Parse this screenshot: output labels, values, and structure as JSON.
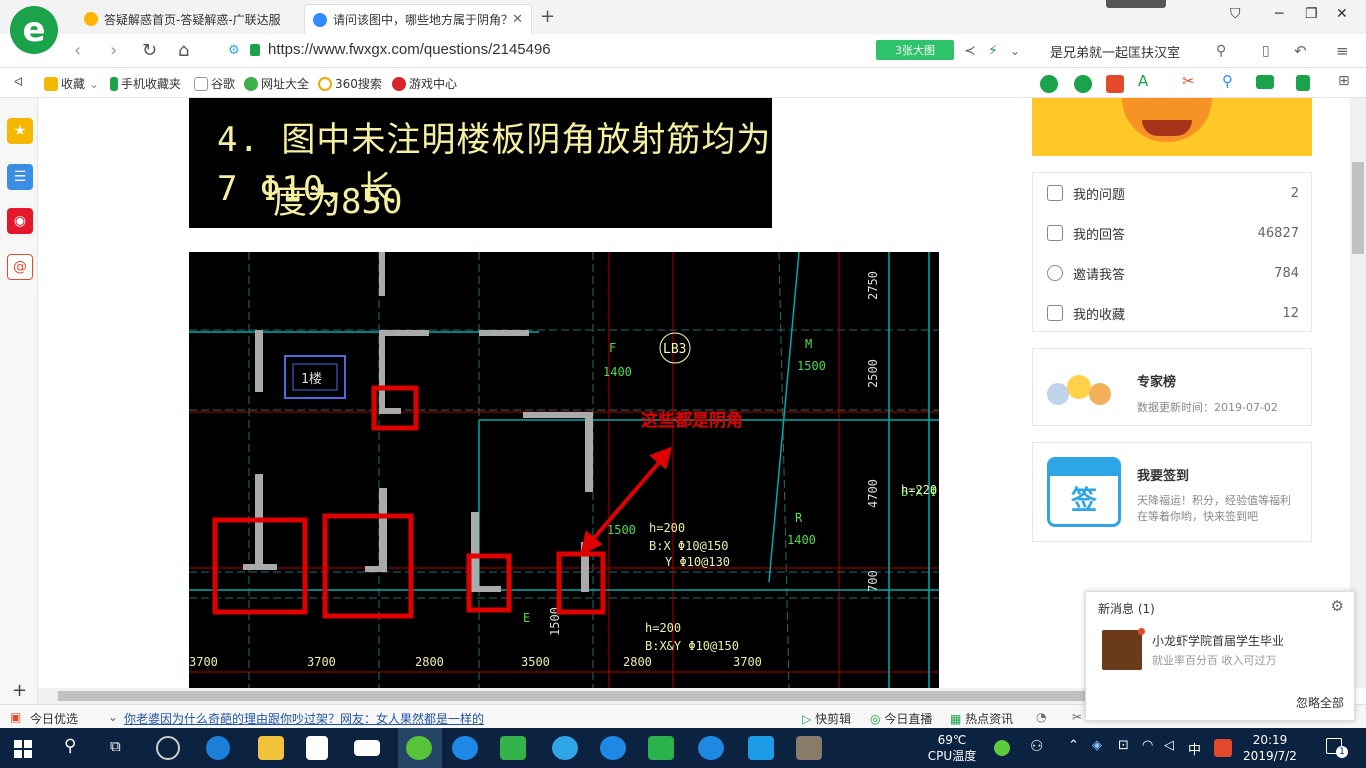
{
  "tabs": [
    {
      "label": "答疑解惑首页-答疑解惑-广联达服"
    },
    {
      "label": "请问该图中，哪些地方属于阴角？"
    }
  ],
  "address": {
    "url": "https://www.fwxgx.com/questions/2145496",
    "big_image_btn": "3张大图",
    "search_text": "是兄弟就一起匡扶汉室"
  },
  "bookmarks": [
    "收藏",
    "手机收藏夹",
    "谷歌",
    "网址大全",
    "360搜索",
    "游戏中心"
  ],
  "cad_text": {
    "line1": "4. 图中未注明楼板阴角放射筋均为7 Φ10，长",
    "line2": "度为850",
    "annotation": "这些都是阴角"
  },
  "cad_labels": [
    "1楼",
    "LB3",
    "F",
    "1400",
    "M",
    "1500",
    "2750",
    "2500",
    "4700",
    "h=220",
    "B:X Φ",
    "h=200",
    "B:X Φ10@150",
    "Y Φ10@130",
    "R",
    "1400",
    "h=200",
    "B:X&Y Φ10@150",
    "3700",
    "3700",
    "2800",
    "3500",
    "2800",
    "3700",
    "1500",
    "700",
    "E",
    "1500"
  ],
  "side_panel": {
    "items": [
      {
        "label": "我的问题",
        "count": "2"
      },
      {
        "label": "我的回答",
        "count": "46827"
      },
      {
        "label": "邀请我答",
        "count": "784"
      },
      {
        "label": "我的收藏",
        "count": "12"
      }
    ],
    "expert": {
      "title": "专家榜",
      "subtitle": "数据更新时间：2019-07-02"
    },
    "signin": {
      "title": "我要签到",
      "badge": "签",
      "desc": "天降福运！积分，经验值等福利在等着你哟，快来签到吧"
    }
  },
  "notification": {
    "header": "新消息 (1)",
    "message": "小龙虾学院首届学生毕业",
    "sub": "就业率百分百 收入可过万",
    "ignore": "忽略全部"
  },
  "statusbar": {
    "today": "今日优选",
    "news": "你老婆因为什么奇葩的理由跟你吵过架？网友：女人果然都是一样的",
    "items": [
      "快剪辑",
      "今日直播",
      "热点资讯"
    ]
  },
  "taskbar": {
    "temp": "69℃",
    "temp_label": "CPU温度",
    "ime": "中",
    "time": "20:19",
    "date": "2019/7/2",
    "notif_count": "1"
  },
  "colors": {
    "brand_green": "#1aa34a",
    "cad_red": "#e00000",
    "cad_yellow": "#f5f0a0",
    "taskbar": "#0b2340"
  }
}
